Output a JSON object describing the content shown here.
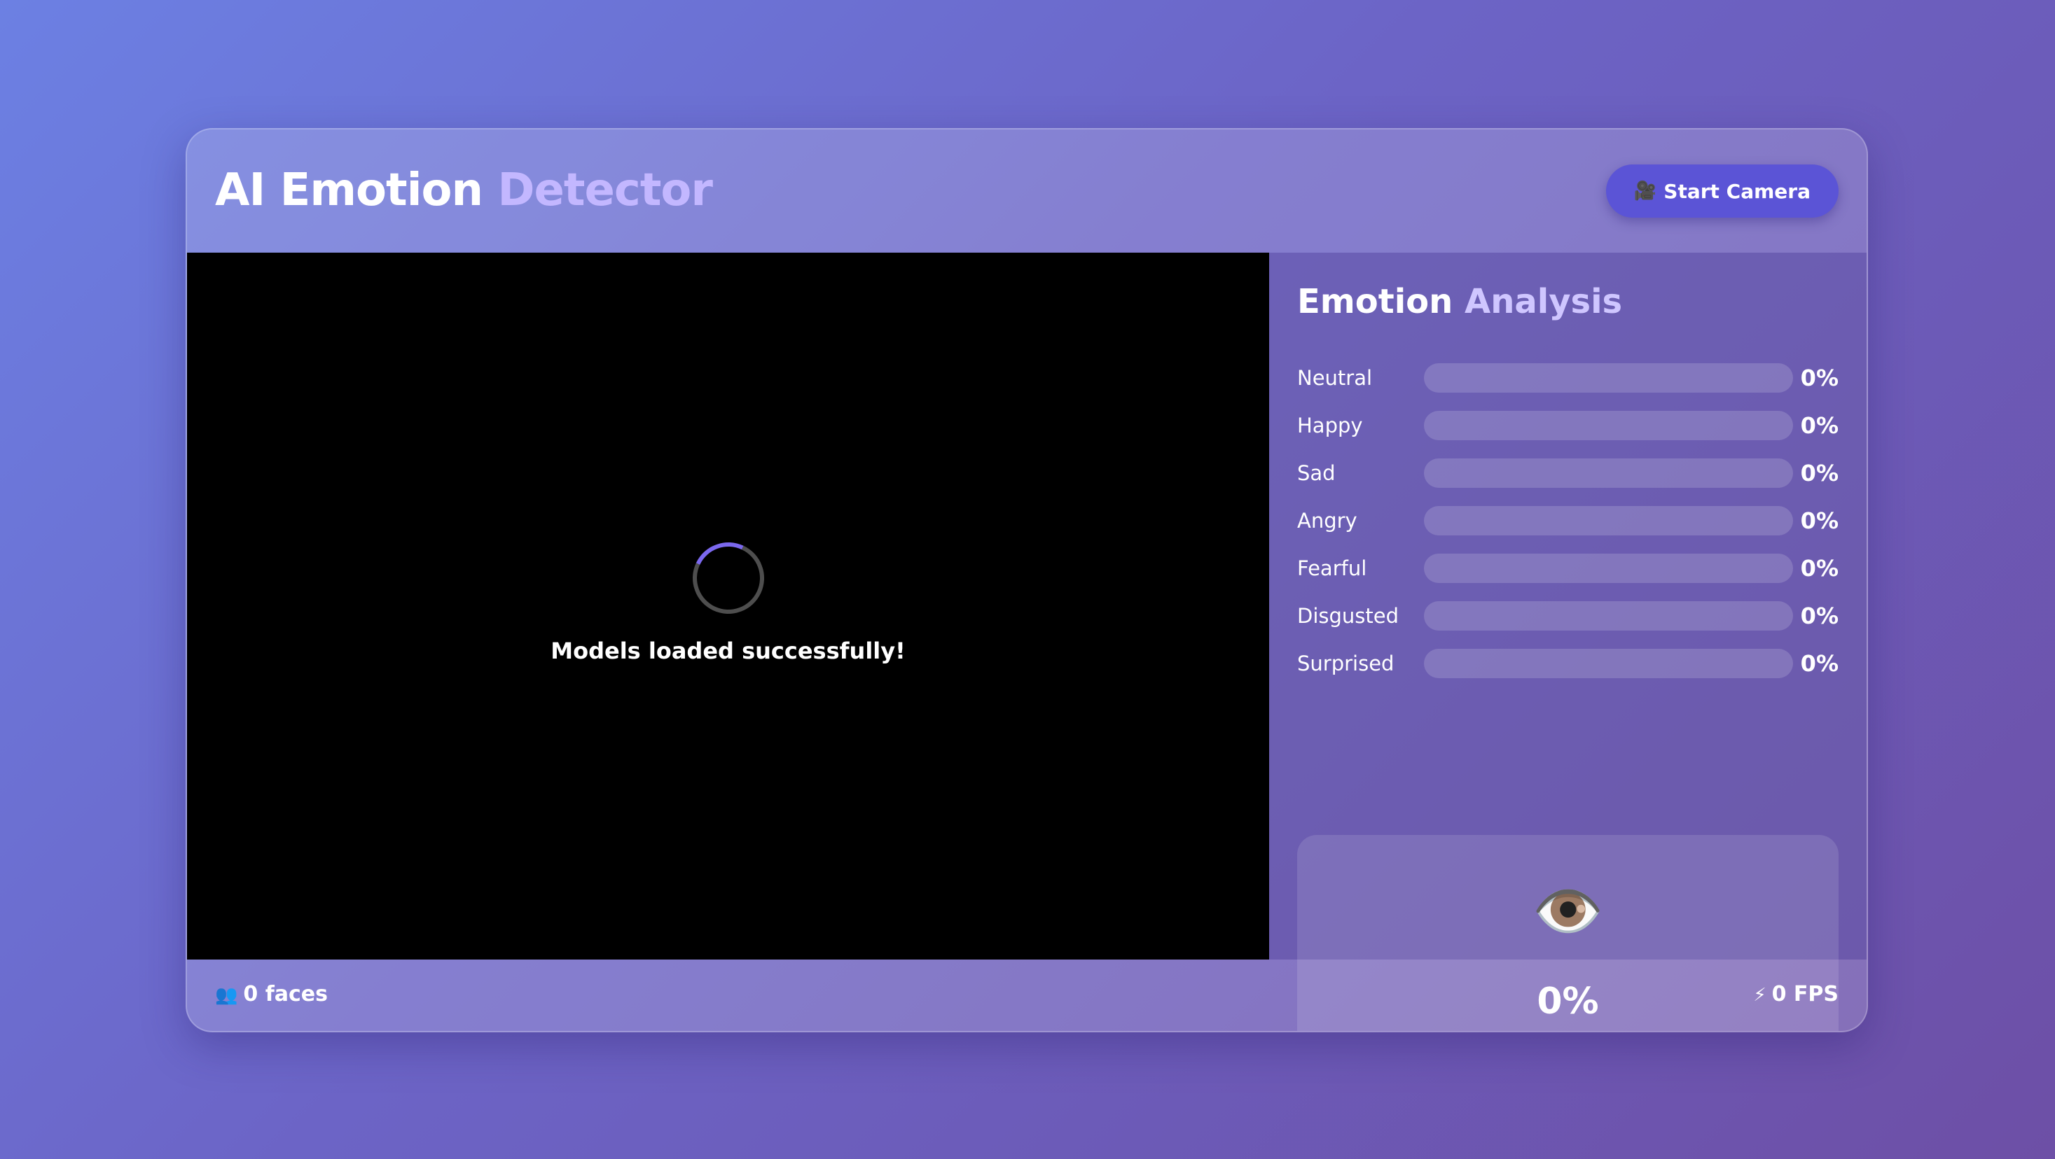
{
  "header": {
    "title_part1": "AI Emotion",
    "title_part2": "Detector",
    "start_button_label": "Start Camera",
    "start_button_icon": "🎥"
  },
  "video": {
    "status_message": "Models loaded successfully!"
  },
  "panel": {
    "title_part1": "Emotion",
    "title_part2": "Analysis",
    "emotions": [
      {
        "label": "Neutral",
        "value": "0%",
        "level": 0
      },
      {
        "label": "Happy",
        "value": "0%",
        "level": 0
      },
      {
        "label": "Sad",
        "value": "0%",
        "level": 0
      },
      {
        "label": "Angry",
        "value": "0%",
        "level": 0
      },
      {
        "label": "Fearful",
        "value": "0%",
        "level": 0
      },
      {
        "label": "Disgusted",
        "value": "0%",
        "level": 0
      },
      {
        "label": "Surprised",
        "value": "0%",
        "level": 0
      }
    ],
    "dominant": {
      "icon": "👁️",
      "value": "0%"
    }
  },
  "footer": {
    "faces_icon": "👥",
    "faces_label": "0 faces",
    "fps_icon": "⚡",
    "fps_label": "0 FPS"
  },
  "colors": {
    "accent_button": "#5b54d6",
    "title_highlight": "#c3b7ff",
    "spinner_accent": "#7b68ee"
  }
}
